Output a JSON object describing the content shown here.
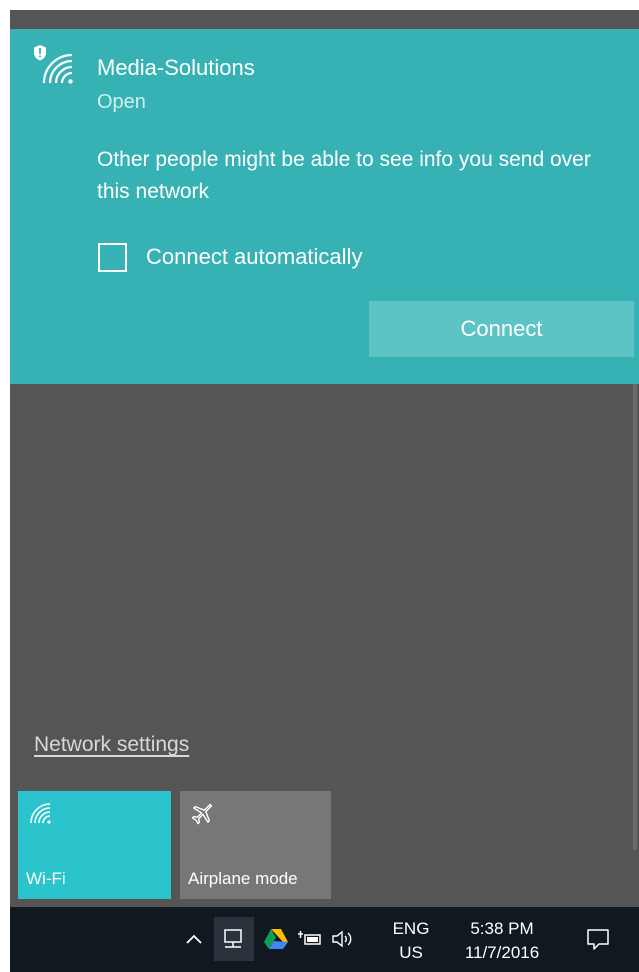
{
  "network": {
    "name": "Media-Solutions",
    "status": "Open",
    "warning": "Other people might be able to see info you send over this network",
    "auto_connect_label": "Connect automatically",
    "auto_connect_checked": false,
    "connect_label": "Connect"
  },
  "network_settings_label": "Network settings",
  "quick_actions": [
    {
      "label": "Wi-Fi",
      "icon": "wifi-icon",
      "active": true
    },
    {
      "label": "Airplane mode",
      "icon": "airplane-icon",
      "active": false
    }
  ],
  "taskbar": {
    "language": {
      "line1": "ENG",
      "line2": "US"
    },
    "clock": {
      "time": "5:38 PM",
      "date": "11/7/2016"
    },
    "tray_icons": [
      "chevron-up-icon",
      "network-icon",
      "google-drive-icon",
      "battery-icon",
      "volume-icon",
      "action-center-icon"
    ]
  },
  "colors": {
    "card_bg": "#36b1b4",
    "connect_bg": "#5dc4c6",
    "flyout_bg": "#555555",
    "wifi_tile_bg": "#2cc4cc",
    "airplane_tile_bg": "#777777",
    "taskbar_bg": "#101820"
  }
}
